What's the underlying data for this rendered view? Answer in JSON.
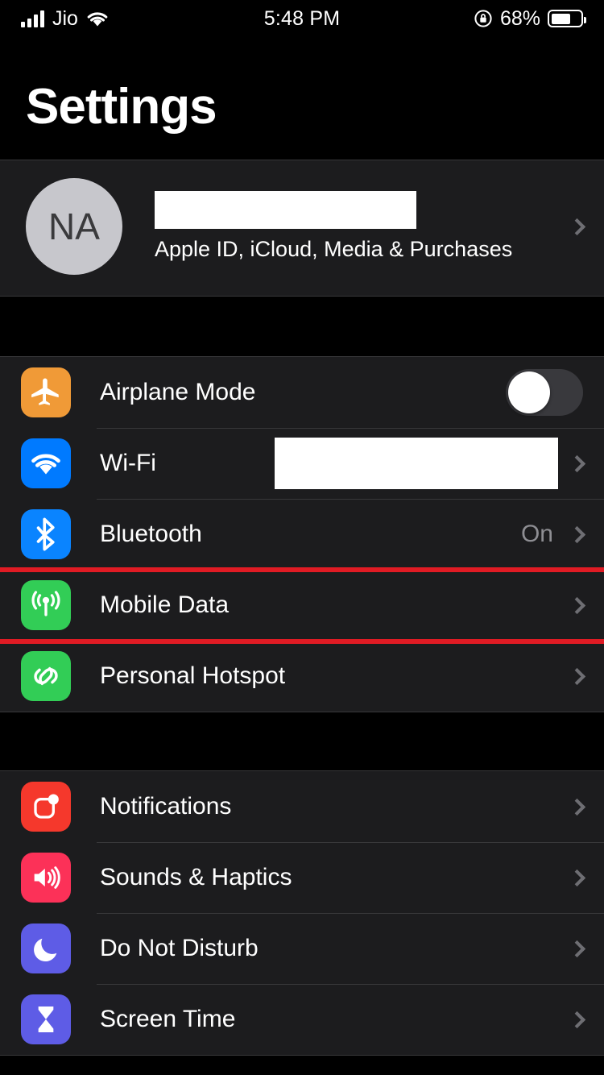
{
  "status_bar": {
    "carrier": "Jio",
    "signal_icon": "cellular-signal-icon",
    "wifi_icon": "wifi-icon",
    "time": "5:48 PM",
    "rotation_lock_icon": "rotation-lock-icon",
    "battery_percent": "68%",
    "battery_level": 68,
    "battery_icon": "battery-icon"
  },
  "header": {
    "title": "Settings"
  },
  "account": {
    "avatar_initials": "NA",
    "name_redacted": true,
    "subtitle": "Apple ID, iCloud, Media & Purchases",
    "chevron_icon": "chevron-right-icon"
  },
  "groups": [
    {
      "id": "connectivity",
      "rows": [
        {
          "id": "airplane-mode",
          "label": "Airplane Mode",
          "icon": "airplane-icon",
          "icon_color": "#F09A37",
          "accessory": "toggle",
          "toggle_on": false,
          "value": ""
        },
        {
          "id": "wifi",
          "label": "Wi-Fi",
          "icon": "wifi-icon",
          "icon_color": "#007AFF",
          "accessory": "redacted-value",
          "value": ""
        },
        {
          "id": "bluetooth",
          "label": "Bluetooth",
          "icon": "bluetooth-icon",
          "icon_color": "#0A84FF",
          "accessory": "value-chevron",
          "value": "On"
        },
        {
          "id": "mobile-data",
          "label": "Mobile Data",
          "icon": "antenna-radiowaves-icon",
          "icon_color": "#32CD56",
          "accessory": "chevron",
          "value": "",
          "highlighted": true
        },
        {
          "id": "personal-hotspot",
          "label": "Personal Hotspot",
          "icon": "personal-hotspot-icon",
          "icon_color": "#32CD56",
          "accessory": "chevron",
          "value": ""
        }
      ]
    },
    {
      "id": "notifications-sounds",
      "rows": [
        {
          "id": "notifications",
          "label": "Notifications",
          "icon": "notifications-badge-icon",
          "icon_color": "#F5382C",
          "accessory": "chevron",
          "value": ""
        },
        {
          "id": "sounds-haptics",
          "label": "Sounds & Haptics",
          "icon": "speaker-waves-icon",
          "icon_color": "#FC3158",
          "accessory": "chevron",
          "value": ""
        },
        {
          "id": "do-not-disturb",
          "label": "Do Not Disturb",
          "icon": "moon-icon",
          "icon_color": "#5E5CE6",
          "accessory": "chevron",
          "value": ""
        },
        {
          "id": "screen-time",
          "label": "Screen Time",
          "icon": "hourglass-icon",
          "icon_color": "#5E5CE6",
          "accessory": "chevron",
          "value": ""
        }
      ]
    }
  ],
  "annotation": {
    "target": "mobile-data",
    "color": "#E01B24",
    "shape": "rectangle-outline"
  }
}
